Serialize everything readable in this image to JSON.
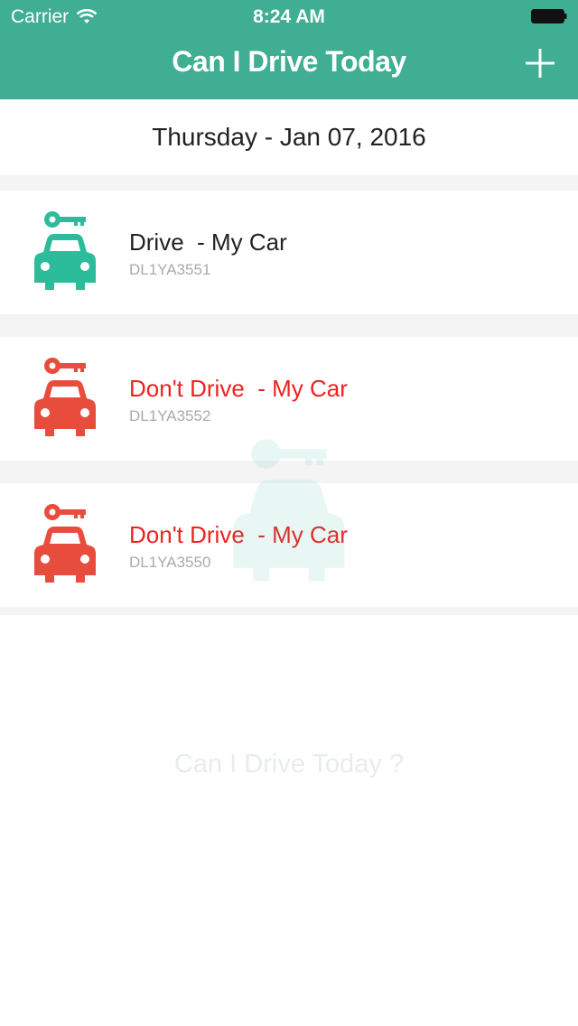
{
  "status_bar": {
    "carrier": "Carrier",
    "time": "8:24 AM"
  },
  "nav": {
    "title": "Can I Drive Today",
    "add_icon": "plus-icon"
  },
  "date": "Thursday - Jan 07, 2016",
  "cars": [
    {
      "status": "Drive",
      "name": "  - My Car",
      "plate": "DL1YA3551",
      "color": "#2dbc9b",
      "icon": "car-key-icon"
    },
    {
      "status": "Don't Drive",
      "name": "  - My Car",
      "plate": "DL1YA3552",
      "color": "#e74c3c",
      "icon": "car-key-icon"
    },
    {
      "status": "Don't Drive",
      "name": "  - My Car",
      "plate": "DL1YA3550",
      "color": "#e74c3c",
      "icon": "car-key-icon"
    }
  ],
  "footer": {
    "tagline": "Can I Drive Today ?"
  },
  "colors": {
    "header": "#3fae92",
    "drive": "#2dbc9b",
    "dont_drive": "#e74c3c",
    "drive_text": "#222222",
    "dont_drive_text": "#ee2222"
  }
}
